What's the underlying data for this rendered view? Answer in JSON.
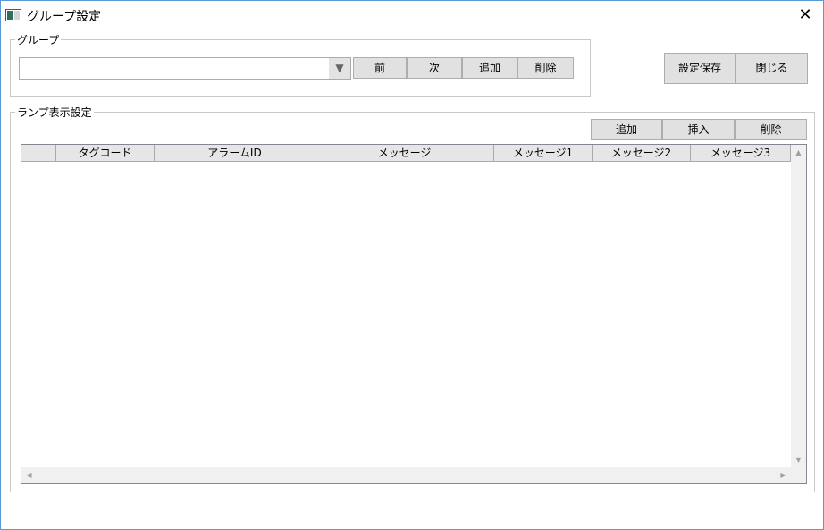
{
  "window": {
    "title": "グループ設定",
    "close_glyph": "✕"
  },
  "group": {
    "legend": "グループ",
    "combo_value": "",
    "combo_arrow": "▼",
    "buttons": {
      "prev": "前",
      "next": "次",
      "add": "追加",
      "delete": "削除"
    }
  },
  "actions": {
    "save": "設定保存",
    "close": "閉じる"
  },
  "lamp": {
    "legend": "ランプ表示設定",
    "buttons": {
      "add": "追加",
      "insert": "挿入",
      "delete": "削除"
    },
    "columns": [
      "",
      "タグコード",
      "アラームID",
      "メッセージ",
      "メッセージ1",
      "メッセージ2",
      "メッセージ3"
    ],
    "rows": []
  },
  "scroll": {
    "up": "▲",
    "down": "▼",
    "left": "◀",
    "right": "▶"
  }
}
